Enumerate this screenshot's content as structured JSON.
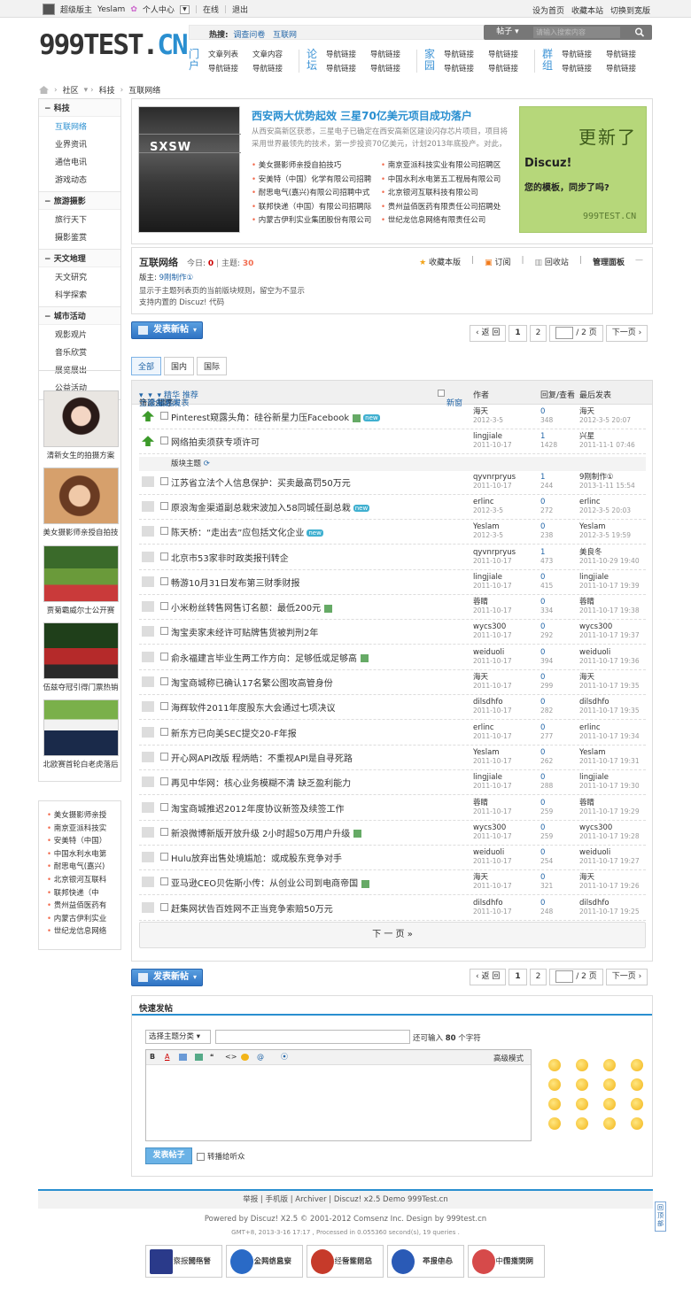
{
  "topbar": {
    "site_role": "超级版主",
    "user": "Yeslam",
    "center": "个人中心",
    "status": "在线",
    "logout": "退出",
    "links": [
      "设为首页",
      "收藏本站",
      "切换到宽版"
    ]
  },
  "logo": {
    "main": "999TEST.",
    "ext": "CN"
  },
  "hot": {
    "label": "热搜:",
    "items": [
      "调查问卷",
      "互联网"
    ]
  },
  "search": {
    "type": "帖子",
    "placeholder": "请输入搜索内容"
  },
  "nav": [
    {
      "cap": "门户",
      "links": [
        "文章列表",
        "文章内容",
        "导航链接",
        "导航链接"
      ]
    },
    {
      "cap": "论坛",
      "links": [
        "导航链接",
        "导航链接",
        "导航链接",
        "导航链接"
      ]
    },
    {
      "cap": "家园",
      "links": [
        "导航链接",
        "导航链接",
        "导航链接",
        "导航链接"
      ]
    },
    {
      "cap": "群组",
      "links": [
        "导航链接",
        "导航链接",
        "导航链接",
        "导航链接"
      ]
    }
  ],
  "breadcrumb": [
    "社区",
    "科技",
    "互联网络"
  ],
  "sidebar": {
    "groups": [
      {
        "title": "科技",
        "items": [
          "互联网络",
          "业界资讯",
          "通信电讯",
          "游戏动态"
        ]
      },
      {
        "title": "旅游摄影",
        "items": [
          "旅行天下",
          "摄影鉴赏"
        ]
      },
      {
        "title": "天文地理",
        "items": [
          "天文研究",
          "科学探索"
        ]
      },
      {
        "title": "城市活动",
        "items": [
          "观影观片",
          "音乐欣赏",
          "展览展出",
          "公益活动"
        ]
      }
    ],
    "pics": [
      "清新女生的拍摄方案",
      "美女摄影师亲授自拍技",
      "贾菊霸威尔士公开赛",
      "伍兹夺冠引得门票热销",
      "北欧赛首轮白老虎落后"
    ],
    "list": [
      "美女摄影师亲授",
      "南京亚派科技实",
      "安美特（中国）",
      "中国水利水电第",
      "耐思电气(嘉兴)",
      "北京银河互联科",
      "联邦快递（中",
      "贵州益佰医药有",
      "内蒙古伊利实业",
      "世纪龙信息网络"
    ]
  },
  "featured": {
    "image_caption": "SXSW",
    "title": "西安两大优势起效 三星70亿美元项目成功落户",
    "desc": "从西安高新区获悉，三星电子已确定在西安高新区建设闪存芯片项目，项目将采用世界最领先的技术，第一步投资70亿美元，计划2013年底投产。对此，",
    "items": [
      "美女摄影师亲授自拍技巧",
      "南京亚派科技实业有限公司招聘区",
      "安美特（中国）化学有限公司招聘",
      "中国水利水电第五工程局有限公司",
      "耐思电气(嘉兴)有限公司招聘中式",
      "北京银河互联科技有限公司",
      "联邦快递（中国）有限公司招聘际",
      "贵州益佰医药有限责任公司招聘处",
      "内蒙古伊利实业集团股份有限公司",
      "世纪龙信息网络有限责任公司"
    ],
    "ad": {
      "l1": "更新了",
      "l2": "Discuz!",
      "l3": "您的模板，同步了吗?",
      "l4": "999TEST.CN"
    }
  },
  "forum": {
    "name": "互联网络",
    "today_label": "今日:",
    "today": "0",
    "topics_label": "主题:",
    "topics": "30",
    "actions": [
      "收藏本版",
      "订阅",
      "回收站",
      "管理面板"
    ],
    "moderator_label": "版主:",
    "moderator": "9刚制作①",
    "rules": [
      "显示于主题列表页的当前版块规则，留空为不显示",
      "支持内置的 Discuz! 代码"
    ]
  },
  "post_btn": "发表新帖",
  "pager": {
    "back": "返 回",
    "p1": "1",
    "p2": "2",
    "total": "/ 2 页",
    "next": "下一页"
  },
  "tabs": [
    "全部",
    "国内",
    "国际"
  ],
  "thead": {
    "filter": "筛选:",
    "all_topics": "全部主题",
    "all_time": "全部时间",
    "sort": "排序:",
    "last_post": "最后发表",
    "digest": "精华",
    "recommend": "推荐",
    "newwin": "新窗",
    "author": "作者",
    "replies": "回复/查看",
    "last": "最后发表"
  },
  "sticky_sep": "版块主题",
  "threads": [
    {
      "title": "Pinterest窥露头角：硅谷新星力压Facebook",
      "author": "海天",
      "date": "2012-3-5",
      "r": "0",
      "v": "348",
      "lp": "海天",
      "lpt": "2012-3-5 20:07",
      "up": true,
      "att": true,
      "new": true
    },
    {
      "title": "网络拍卖须获专项许可",
      "author": "lingjiale",
      "date": "2011-10-17",
      "r": "1",
      "v": "1428",
      "lp": "兴星",
      "lpt": "2011-11-1 07:46",
      "up": true
    },
    {
      "title": "江苏省立法个人信息保护：买卖最高罚50万元",
      "author": "qyvnrpryus",
      "date": "2011-10-17",
      "r": "1",
      "v": "244",
      "lp": "9刚制作①",
      "lpt": "2013-1-11 15:54"
    },
    {
      "title": "原浪淘金渠道副总栽宋波加入58同城任副总栽",
      "author": "erlinc",
      "date": "2012-3-5",
      "r": "0",
      "v": "272",
      "lp": "erlinc",
      "lpt": "2012-3-5 20:03",
      "new": true
    },
    {
      "title": "陈天桥：“走出去”应包括文化企业",
      "author": "Yeslam",
      "date": "2012-3-5",
      "r": "0",
      "v": "238",
      "lp": "Yeslam",
      "lpt": "2012-3-5 19:59",
      "new": true
    },
    {
      "title": "北京市53家非时政类报刊转企",
      "author": "qyvnrpryus",
      "date": "2011-10-17",
      "r": "1",
      "v": "473",
      "lp": "美良冬",
      "lpt": "2011-10-29 19:40"
    },
    {
      "title": "畅游10月31日发布第三财季财报",
      "author": "lingjiale",
      "date": "2011-10-17",
      "r": "0",
      "v": "415",
      "lp": "lingjiale",
      "lpt": "2011-10-17 19:39"
    },
    {
      "title": "小米粉丝转售网售订名额：最低200元",
      "author": "蓉睛",
      "date": "2011-10-17",
      "r": "0",
      "v": "334",
      "lp": "蓉睛",
      "lpt": "2011-10-17 19:38",
      "att": true
    },
    {
      "title": "淘宝卖家未经许可贴牌售货被判刑2年",
      "author": "wycs300",
      "date": "2011-10-17",
      "r": "0",
      "v": "292",
      "lp": "wycs300",
      "lpt": "2011-10-17 19:37"
    },
    {
      "title": "俞永福建言毕业生两工作方向：足够低或足够高",
      "author": "weiduoli",
      "date": "2011-10-17",
      "r": "0",
      "v": "394",
      "lp": "weiduoli",
      "lpt": "2011-10-17 19:36",
      "att": true
    },
    {
      "title": "淘宝商城称已确认17名繁公图攻高管身份",
      "author": "海天",
      "date": "2011-10-17",
      "r": "0",
      "v": "299",
      "lp": "海天",
      "lpt": "2011-10-17 19:35"
    },
    {
      "title": "海辉软件2011年度股东大会通过七项决议",
      "author": "dilsdhfo",
      "date": "2011-10-17",
      "r": "0",
      "v": "282",
      "lp": "dilsdhfo",
      "lpt": "2011-10-17 19:35"
    },
    {
      "title": "新东方已向美SEC提交20-F年报",
      "author": "erlinc",
      "date": "2011-10-17",
      "r": "0",
      "v": "277",
      "lp": "erlinc",
      "lpt": "2011-10-17 19:34"
    },
    {
      "title": "开心网API改版 程炳皓：不重视API是自寻死路",
      "author": "Yeslam",
      "date": "2011-10-17",
      "r": "0",
      "v": "262",
      "lp": "Yeslam",
      "lpt": "2011-10-17 19:31"
    },
    {
      "title": "再见中华网：核心业务模糊不清 缺乏盈利能力",
      "author": "lingjiale",
      "date": "2011-10-17",
      "r": "0",
      "v": "288",
      "lp": "lingjiale",
      "lpt": "2011-10-17 19:30"
    },
    {
      "title": "淘宝商城推迟2012年度协议新签及续签工作",
      "author": "蓉睛",
      "date": "2011-10-17",
      "r": "0",
      "v": "259",
      "lp": "蓉睛",
      "lpt": "2011-10-17 19:29"
    },
    {
      "title": "新浪微博新版开放升级 2小时超50万用户升级",
      "author": "wycs300",
      "date": "2011-10-17",
      "r": "0",
      "v": "259",
      "lp": "wycs300",
      "lpt": "2011-10-17 19:28",
      "att": true
    },
    {
      "title": "Hulu放弃出售处境尴尬：或成股东竞争对手",
      "author": "weiduoli",
      "date": "2011-10-17",
      "r": "0",
      "v": "254",
      "lp": "weiduoli",
      "lpt": "2011-10-17 19:27"
    },
    {
      "title": "亚马逊CEO贝佐斯小传：从创业公司到电商帝国",
      "author": "海天",
      "date": "2011-10-17",
      "r": "0",
      "v": "321",
      "lp": "海天",
      "lpt": "2011-10-17 19:26",
      "att": true
    },
    {
      "title": "赶集网状告百姓网不正当竞争索赔50万元",
      "author": "dilsdhfo",
      "date": "2011-10-17",
      "r": "0",
      "v": "248",
      "lp": "dilsdhfo",
      "lpt": "2011-10-17 19:25"
    }
  ],
  "next_page": "下 一 页  »",
  "quick": {
    "title": "快速发帖",
    "cat": "选择主题分类",
    "limit_pre": "还可输入",
    "limit": "80",
    "limit_post": "个字符",
    "adv": "高级模式",
    "submit": "发表帖子",
    "share": "转播给听众"
  },
  "footer": {
    "links": "举报 | 手机版 | Archiver | Discuz! x2.5 Demo 999Test.cn",
    "powered": "Powered by Discuz! X2.5 © 2001-2012 Comsenz Inc. Design by 999test.cn",
    "gmt": "GMT+8, 2013-3-16 17:17 , Processed in 0.055360 second(s), 19 queries .",
    "badges": [
      [
        "网络警",
        "察报警平台"
      ],
      [
        "公共信息安",
        "全网络监察"
      ],
      [
        "经营性网站",
        "备案信息"
      ],
      [
        "不良信息",
        "举报中心"
      ],
      [
        "中国文明网",
        "传播文明"
      ]
    ],
    "totop": "回顶部"
  }
}
